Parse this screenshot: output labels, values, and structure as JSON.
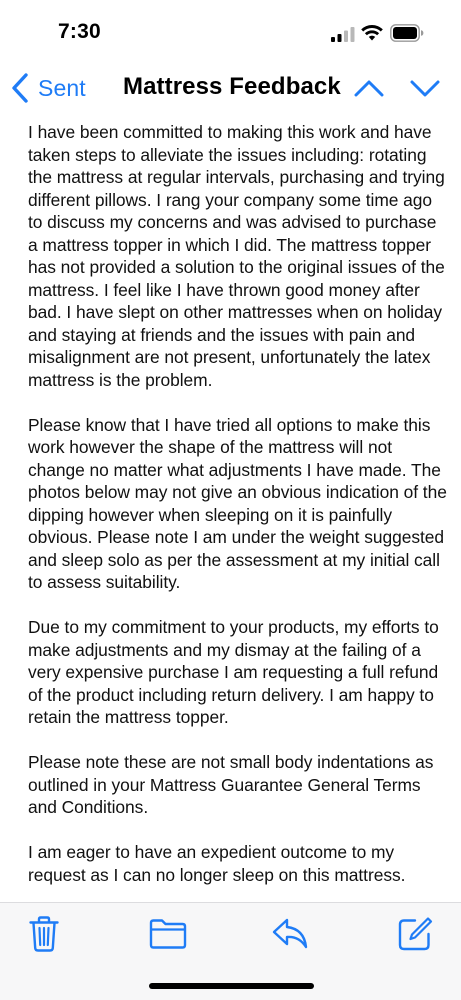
{
  "status_bar": {
    "time": "7:30"
  },
  "nav": {
    "back_label": "Sent",
    "title": "Mattress Feedback",
    "accent_color": "#1f7cf6"
  },
  "body": {
    "paragraphs": [
      "I have been committed to making this work and have taken steps to alleviate the issues including: rotating the mattress at regular intervals, purchasing and trying different pillows. I rang your company some time ago to discuss my concerns and was advised to purchase a mattress topper in which I did. The mattress topper has not provided a solution to the original issues of the mattress. I feel like I have thrown good money after bad. I have slept on other mattresses when on holiday and staying at friends and the issues with pain and misalignment are not present, unfortunately the latex mattress is the problem.",
      "Please know that I have tried all options to make this work however the shape of the mattress will not change no matter what adjustments I have made. The photos below may not give an obvious indication of the dipping however when sleeping on it is painfully obvious. Please note I am under the weight suggested and sleep solo as per the assessment at my initial call to assess suitability.",
      "Due to my commitment to your products, my efforts to make adjustments and my dismay at the failing of a very expensive purchase I am requesting a full refund of the product including return delivery. I am happy to retain the mattress topper.",
      "Please note these are not small body indentations as outlined in your Mattress Guarantee General Terms and Conditions.",
      "I am eager to have an expedient outcome to my request as I can no longer sleep on this mattress."
    ]
  },
  "toolbar": {
    "icons": [
      "trash-icon",
      "folder-icon",
      "reply-icon",
      "compose-icon"
    ]
  }
}
